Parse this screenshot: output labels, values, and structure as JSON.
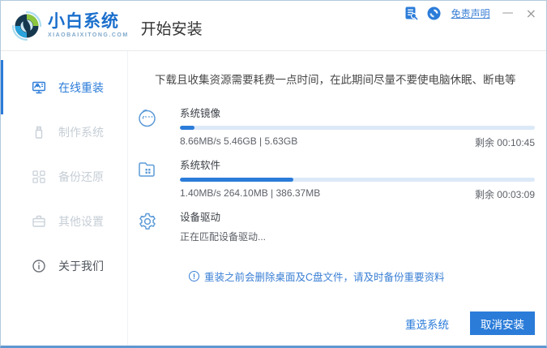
{
  "titlebar": {
    "logo_title": "小白系统",
    "logo_subtitle": "XIAOBAIXITONG.COM",
    "page_title": "开始安装",
    "disclaimer_link": "免责声明",
    "minimize_label": "—",
    "close_label": "×"
  },
  "sidebar": {
    "items": [
      {
        "label": "在线重装",
        "icon": "monitor-reinstall-icon",
        "state": "active"
      },
      {
        "label": "制作系统",
        "icon": "usb-drive-icon",
        "state": "disabled"
      },
      {
        "label": "备份还原",
        "icon": "backup-grid-icon",
        "state": "disabled"
      },
      {
        "label": "其他设置",
        "icon": "briefcase-icon",
        "state": "disabled"
      },
      {
        "label": "关于我们",
        "icon": "info-circle-icon",
        "state": "normal"
      }
    ]
  },
  "main": {
    "tip": "下载且收集资源需要耗费一点时间，在此期间尽量不要使电脑休眠、断电等",
    "tasks": [
      {
        "name": "系统镜像",
        "icon": "mascot-face-icon",
        "stats": "8.66MB/s 5.46GB | 5.63GB",
        "remaining": "剩余 00:10:45",
        "percent": 4
      },
      {
        "name": "系统软件",
        "icon": "folder-apps-icon",
        "stats": "1.40MB/s 264.10MB | 386.37MB",
        "remaining": "剩余 00:03:09",
        "percent": 32
      },
      {
        "name": "设备驱动",
        "icon": "gear-icon",
        "status": "正在匹配设备驱动..."
      }
    ],
    "warning_icon_label": "!",
    "warning": "重装之前会删除桌面及C盘文件，请及时备份重要资料"
  },
  "footer": {
    "reselect_label": "重选系统",
    "cancel_label": "取消安装"
  },
  "colors": {
    "accent": "#2b7cd9",
    "progress_track": "#dce9f8",
    "warning_blue": "#3a7fd5",
    "window_bottom_border": "#5f98d0",
    "inactive_text": "#c6ced6"
  }
}
